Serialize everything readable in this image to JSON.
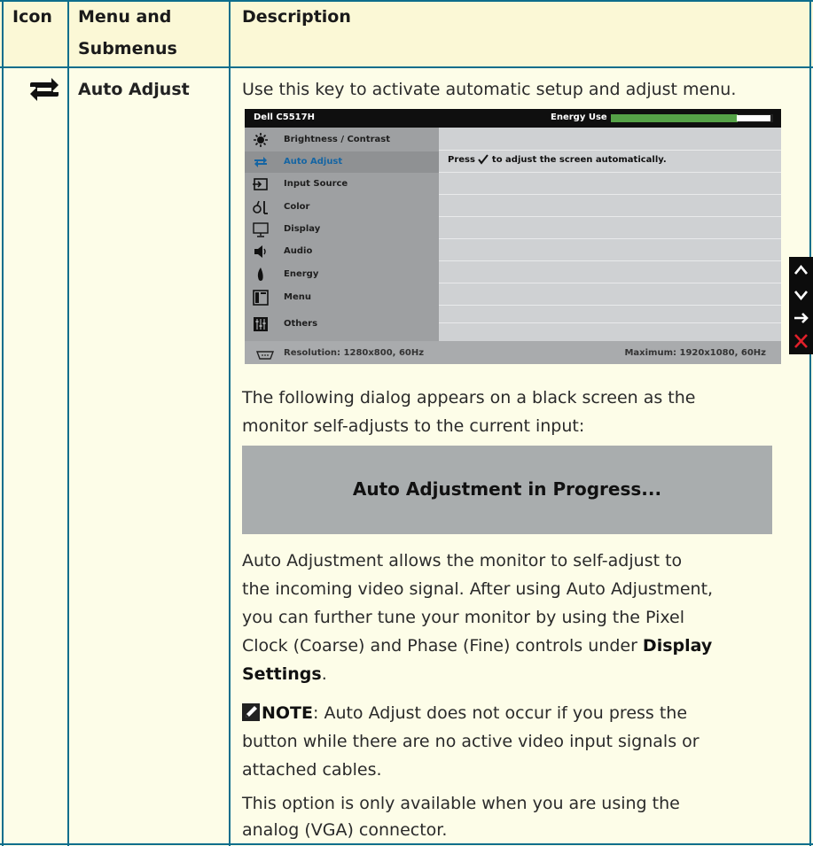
{
  "header": {
    "col1": "Icon",
    "col2_line1": "Menu and",
    "col2_line2": "Submenus",
    "col3": "Description"
  },
  "row": {
    "icon": "auto-adjust-arrows-icon",
    "menu_name": "Auto Adjust",
    "intro": "Use this key to activate automatic setup and adjust menu.",
    "osd": {
      "model": "Dell C5517H",
      "energy_label": "Energy Use",
      "energy_level_fraction": 0.78,
      "menu_items": [
        {
          "label": "Brightness / Contrast",
          "icon": "brightness-icon",
          "selected": false
        },
        {
          "label": "Auto Adjust",
          "icon": "auto-adjust-icon",
          "selected": true
        },
        {
          "label": "Input Source",
          "icon": "input-source-icon",
          "selected": false
        },
        {
          "label": "Color",
          "icon": "color-icon",
          "selected": false
        },
        {
          "label": "Display",
          "icon": "display-icon",
          "selected": false
        },
        {
          "label": "Audio",
          "icon": "audio-icon",
          "selected": false
        },
        {
          "label": "Energy",
          "icon": "energy-icon",
          "selected": false
        },
        {
          "label": "Menu",
          "icon": "menu-icon",
          "selected": false
        },
        {
          "label": "Others",
          "icon": "others-icon",
          "selected": false
        }
      ],
      "message_prefix": "Press",
      "message_suffix": "to adjust the screen automatically.",
      "resolution": "Resolution: 1280x800, 60Hz",
      "maximum": "Maximum: 1920x1080, 60Hz",
      "buttons": [
        "up-arrow-icon",
        "down-arrow-icon",
        "right-arrow-icon",
        "close-icon"
      ]
    },
    "dialog_intro_line1": "The following dialog appears on a black screen as the",
    "dialog_intro_line2": "monitor self-adjusts to the current input:",
    "progress_text": "Auto Adjustment in Progress...",
    "para1_line1": "Auto Adjustment allows the monitor to self-adjust to",
    "para1_line2": "the incoming video signal. After using Auto Adjustment,",
    "para1_line3": "you can further tune your monitor by using the Pixel",
    "para1_line4_pre": "Clock (Coarse) and Phase (Fine) controls under ",
    "para1_line4_bold": "Display",
    "para1_line5_bold": "Settings",
    "para1_line5_post": ".",
    "note_label": "NOTE",
    "note_line1": ": Auto Adjust does not occur if you press the",
    "note_line2": "button while there are no active video input signals or",
    "note_line3": "attached cables.",
    "para3_line1": "This option is only available when you are using the",
    "para3_line2": "analog (VGA) connector."
  },
  "colors": {
    "border": "#0d6e8c",
    "page_bg": "#fdfde8",
    "energy_green": "#55a247",
    "selected_text": "#1565a3",
    "close_red": "#e0202a"
  }
}
